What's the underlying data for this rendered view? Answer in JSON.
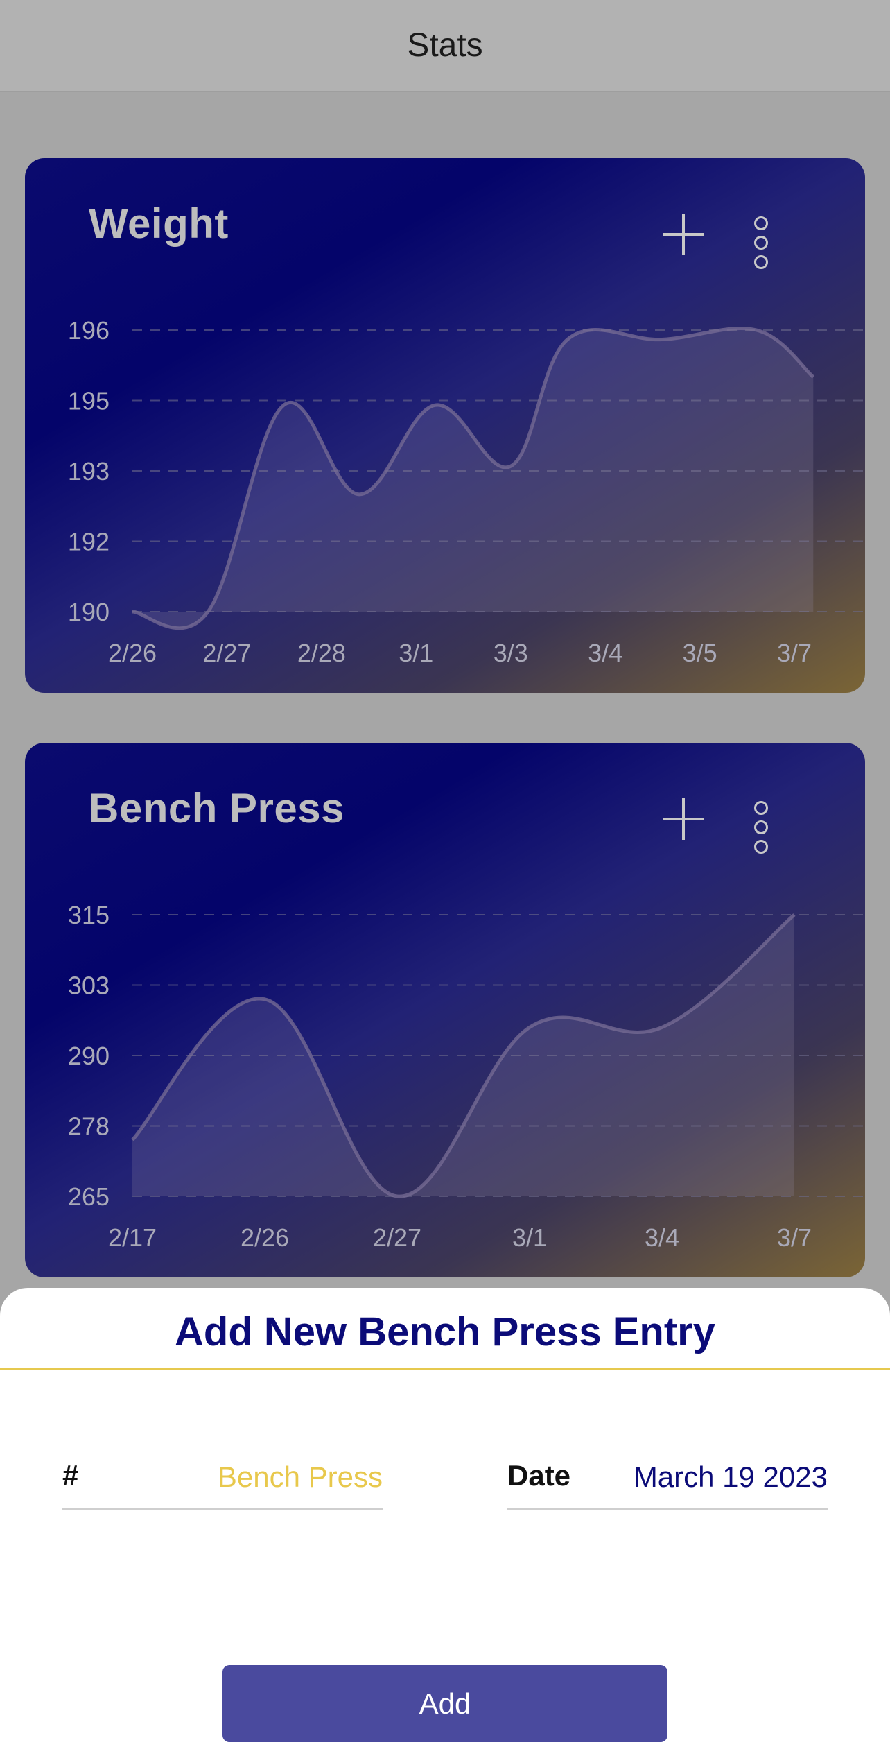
{
  "header": {
    "title": "Stats"
  },
  "icons": {
    "add": "plus-icon",
    "more": "more-vertical-icon"
  },
  "colors": {
    "accent": "#0b0b78",
    "highlight": "#e8c84c",
    "button": "#4a4a9e"
  },
  "cards": [
    {
      "title": "Weight",
      "chart_data": {
        "type": "area",
        "categories": [
          "2/26",
          "2/27",
          "2/28",
          "3/1",
          "3/3",
          "3/4",
          "3/5",
          "3/7"
        ],
        "y_ticks": [
          "196",
          "195",
          "193",
          "192",
          "190"
        ],
        "ylim": [
          190,
          196
        ],
        "grid": true,
        "series": [
          {
            "values": [
              190,
              190,
              194.4,
              192.5,
              194.4,
              193.1,
              195.8,
              195.8,
              196.0,
              195.0
            ]
          }
        ],
        "x_positions": [
          0,
          0.8,
          1.6,
          2.4,
          3.2,
          4.0,
          4.6,
          5.6,
          6.6,
          7.2
        ]
      }
    },
    {
      "title": "Bench Press",
      "chart_data": {
        "type": "area",
        "categories": [
          "2/17",
          "2/26",
          "2/27",
          "3/1",
          "3/4",
          "3/7"
        ],
        "y_ticks": [
          "315",
          "303",
          "290",
          "278",
          "265"
        ],
        "ylim": [
          265,
          315
        ],
        "grid": true,
        "series": [
          {
            "values": [
              275,
              300,
              265,
              295,
              295,
              315
            ]
          }
        ],
        "x_positions": [
          0,
          1,
          2,
          3,
          4,
          5
        ]
      }
    }
  ],
  "sheet": {
    "title": "Add New Bench Press Entry",
    "amount_label": "#",
    "amount_value": "Bench Press",
    "date_label": "Date",
    "date_value": "March 19 2023",
    "submit_label": "Add"
  }
}
